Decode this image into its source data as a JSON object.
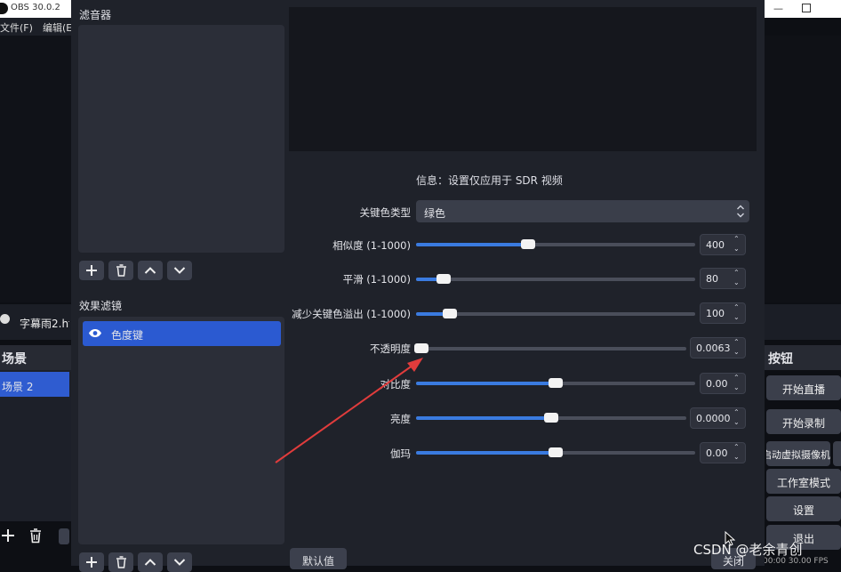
{
  "app": {
    "title": "OBS 30.0.2",
    "menu": [
      "文件(F)",
      "编辑(E"
    ]
  },
  "source": {
    "name": "字幕雨2.ht"
  },
  "scenes": {
    "title": "场景",
    "items": [
      "场景 2"
    ]
  },
  "controls": {
    "title": "按钮",
    "buttons": [
      "开始直播",
      "开始录制",
      "启动虚拟摄像机",
      "工作室模式",
      "设置",
      "退出"
    ]
  },
  "status": {
    "text": "00:00 30.00 FPS"
  },
  "dialog": {
    "audio_filters_label": "滤音器",
    "effect_filters_label": "效果滤镜",
    "effect_filters": [
      {
        "name": "色度键",
        "visible": true
      }
    ],
    "info": "信息：设置仅应用于 SDR 视频",
    "key_color_type": {
      "label": "关键色类型",
      "value": "绿色"
    },
    "properties": [
      {
        "label": "相似度 (1-1000)",
        "value": "400",
        "fraction": 0.4
      },
      {
        "label": "平滑 (1-1000)",
        "value": "80",
        "fraction": 0.1
      },
      {
        "label": "减少关键色溢出 (1-1000)",
        "value": "100",
        "fraction": 0.12
      },
      {
        "label": "不透明度",
        "value": "0.0063",
        "fraction": 0.02
      },
      {
        "label": "对比度",
        "value": "0.00",
        "fraction": 0.5
      },
      {
        "label": "亮度",
        "value": "0.0000",
        "fraction": 0.5
      },
      {
        "label": "伽玛",
        "value": "0.00",
        "fraction": 0.5
      }
    ],
    "defaults_label": "默认值",
    "close_label": "关闭"
  },
  "watermark": "CSDN @老余青创",
  "colors": {
    "accent": "#2b5ad1",
    "slider_fill": "#3a7be0",
    "annotation": "#e03c3c"
  }
}
